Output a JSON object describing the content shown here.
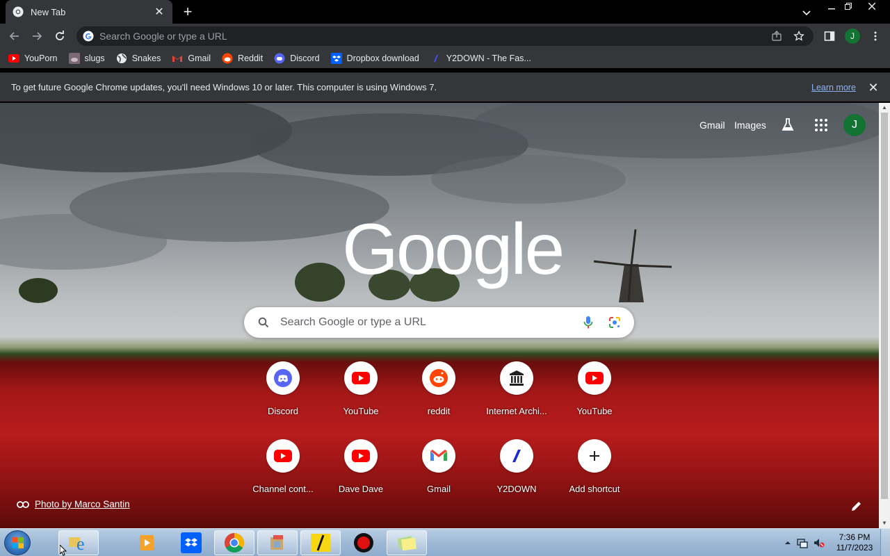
{
  "tab": {
    "title": "New Tab"
  },
  "omnibox": {
    "placeholder": "Search Google or type a URL"
  },
  "profile": {
    "initial": "J"
  },
  "bookmarks": [
    {
      "label": "YouPorn",
      "icon": "youtube-icon"
    },
    {
      "label": "slugs",
      "icon": "slug-icon"
    },
    {
      "label": "Snakes",
      "icon": "globe-icon"
    },
    {
      "label": "Gmail",
      "icon": "gmail-icon"
    },
    {
      "label": "Reddit",
      "icon": "reddit-icon"
    },
    {
      "label": "Discord",
      "icon": "discord-icon"
    },
    {
      "label": "Dropbox download",
      "icon": "dropbox-icon"
    },
    {
      "label": "Y2DOWN - The Fas...",
      "icon": "y2down-icon"
    }
  ],
  "infobar": {
    "message": "To get future Google Chrome updates, you'll need Windows 10 or later. This computer is using Windows 7.",
    "link": "Learn more"
  },
  "ntp": {
    "links": {
      "gmail": "Gmail",
      "images": "Images"
    },
    "logo": "Google",
    "search_placeholder": "Search Google or type a URL",
    "shortcuts": [
      {
        "label": "Discord",
        "icon": "discord-icon"
      },
      {
        "label": "YouTube",
        "icon": "youtube-icon"
      },
      {
        "label": "reddit",
        "icon": "reddit-icon"
      },
      {
        "label": "Internet Archi...",
        "icon": "archive-icon"
      },
      {
        "label": "YouTube",
        "icon": "youtube-icon"
      },
      {
        "label": "Channel cont...",
        "icon": "youtube-icon"
      },
      {
        "label": "Dave Dave",
        "icon": "youtube-icon"
      },
      {
        "label": "Gmail",
        "icon": "gmail-icon"
      },
      {
        "label": "Y2DOWN",
        "icon": "y2down-icon"
      },
      {
        "label": "Add shortcut",
        "icon": "plus-icon"
      }
    ],
    "attribution": "Photo by Marco Santin"
  },
  "taskbar": {
    "time": "7:36 PM",
    "date": "11/7/2023"
  },
  "colors": {
    "chrome_dark": "#35363a",
    "link_blue": "#8ab4f8",
    "profile_green": "#137333",
    "youtube_red": "#ff0000",
    "discord_blurple": "#5865f2",
    "reddit_orange": "#ff4500"
  }
}
